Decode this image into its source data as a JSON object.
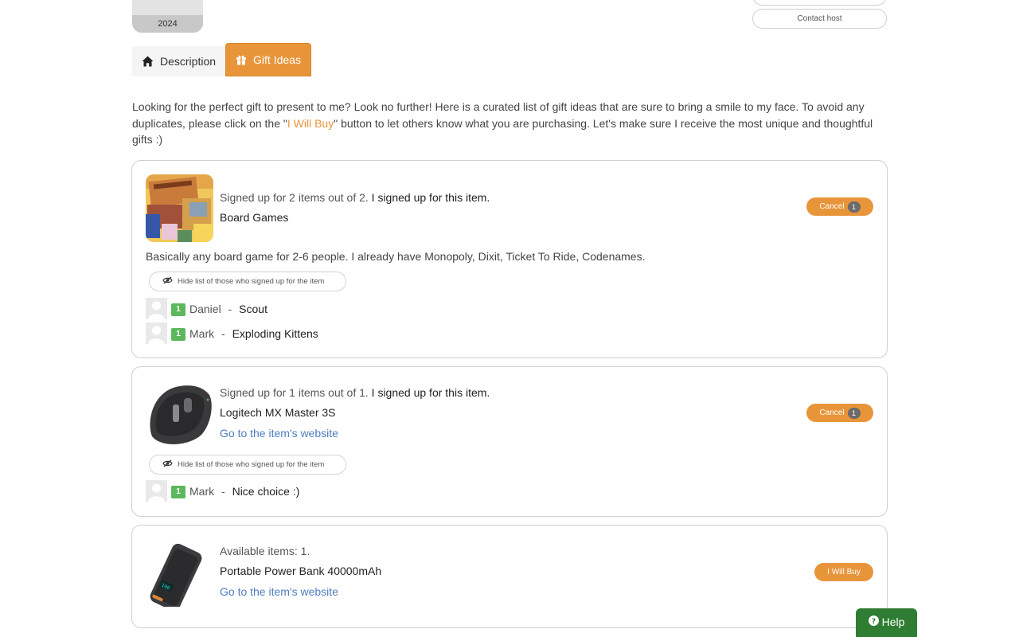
{
  "event": {
    "year": "2024"
  },
  "host": {
    "contact_label": "Contact host"
  },
  "tabs": [
    {
      "label": "Description",
      "icon": "home-icon"
    },
    {
      "label": "Gift Ideas",
      "icon": "gift-icon"
    }
  ],
  "intro": {
    "before": "Looking for the perfect gift to present to me? Look no further! Here is a curated list of gift ideas that are sure to bring a smile to my face. To avoid any duplicates, please click on the \"",
    "highlight": "I Will Buy",
    "after": "\" button to let others know what you are purchasing. Let's make sure I receive the most unique and thoughtful gifts :)"
  },
  "colors": {
    "accent": "#e8953a",
    "link": "#4f7dc0",
    "qty_badge": "#5cb85c",
    "help": "#2e7d32"
  },
  "items": [
    {
      "status": "Signed up for 2 items out of 2.",
      "status_me": "I signed up for this item.",
      "name": "Board Games",
      "description": "Basically any board game for 2-6 people. I already have Monopoly, Dixit, Ticket To Ride, Codenames.",
      "action_label": "Cancel",
      "action_count": "1",
      "hide_list_label": "Hide list of those who signed up for the item",
      "signups": [
        {
          "qty": "1",
          "name": "Daniel",
          "sep": " - ",
          "gift": "Scout"
        },
        {
          "qty": "1",
          "name": "Mark",
          "sep": " - ",
          "gift": "Exploding Kittens"
        }
      ]
    },
    {
      "status": "Signed up for 1 items out of 1.",
      "status_me": "I signed up for this item.",
      "name": "Logitech MX Master 3S",
      "link_label": "Go to the item's website",
      "action_label": "Cancel",
      "action_count": "1",
      "hide_list_label": "Hide list of those who signed up for the item",
      "signups": [
        {
          "qty": "1",
          "name": "Mark",
          "sep": " - ",
          "gift": "Nice choice :)"
        }
      ]
    },
    {
      "status": "Available items: 1.",
      "name": "Portable Power Bank 40000mAh",
      "link_label": "Go to the item's website",
      "action_label": "I Will Buy"
    }
  ],
  "help": {
    "label": "Help"
  }
}
